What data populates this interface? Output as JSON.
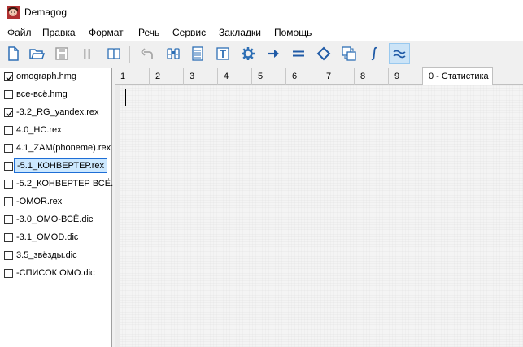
{
  "window": {
    "title": "Demagog"
  },
  "menu": [
    "Файл",
    "Правка",
    "Формат",
    "Речь",
    "Сервис",
    "Закладки",
    "Помощь"
  ],
  "toolbar": {
    "buttons": [
      {
        "icon": "new-document-icon"
      },
      {
        "icon": "open-folder-icon"
      },
      {
        "icon": "save-icon"
      },
      {
        "icon": "pause-icon"
      },
      {
        "icon": "book-icon"
      },
      {
        "icon": "undo-icon"
      },
      {
        "icon": "binoculars-icon"
      },
      {
        "icon": "page-text-icon"
      },
      {
        "icon": "text-t-icon"
      },
      {
        "icon": "gear-icon"
      },
      {
        "icon": "arrow-right-icon"
      },
      {
        "icon": "equals-icon"
      },
      {
        "icon": "diamond-icon"
      },
      {
        "icon": "convert-icon"
      },
      {
        "icon": "integral-icon"
      },
      {
        "icon": "approx-icon",
        "active": true
      }
    ]
  },
  "files": [
    {
      "label": "omograph.hmg",
      "checked": true
    },
    {
      "label": "все-всё.hmg",
      "checked": false
    },
    {
      "label": "-3.2_RG_yandex.rex",
      "checked": true
    },
    {
      "label": "4.0_HC.rex",
      "checked": false
    },
    {
      "label": "4.1_ZAM(phoneme).rex",
      "checked": false
    },
    {
      "label": "-5.1_КОНВЕРТЕР.rex",
      "checked": false,
      "selected": true
    },
    {
      "label": "-5.2_КОНВЕРТЕР ВСЁ.",
      "checked": false
    },
    {
      "label": "-OMOR.rex",
      "checked": false
    },
    {
      "label": "-3.0_OMO-ВСЁ.dic",
      "checked": false
    },
    {
      "label": "-3.1_OMOD.dic",
      "checked": false
    },
    {
      "label": "3.5_звёзды.dic",
      "checked": false
    },
    {
      "label": "-СПИСОК OMO.dic",
      "checked": false
    }
  ],
  "tabs": [
    "1",
    "2",
    "3",
    "4",
    "5",
    "6",
    "7",
    "8",
    "9",
    "0 - Статистика"
  ],
  "active_tab": "0 - Статистика"
}
